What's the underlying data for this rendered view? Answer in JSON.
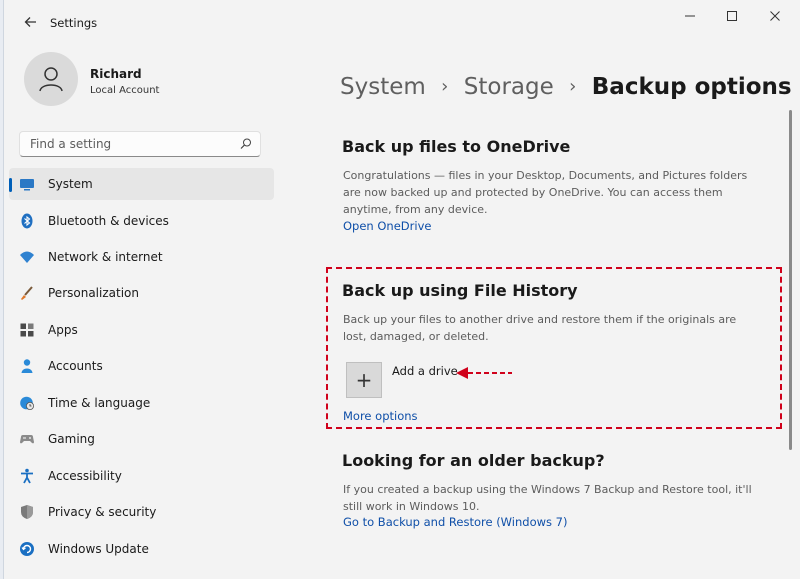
{
  "window": {
    "title": "Settings"
  },
  "user": {
    "name": "Richard",
    "account_type": "Local Account"
  },
  "search": {
    "placeholder": "Find a setting"
  },
  "nav": [
    {
      "label": "System",
      "icon": "monitor-icon",
      "active": true
    },
    {
      "label": "Bluetooth & devices",
      "icon": "bluetooth-icon"
    },
    {
      "label": "Network & internet",
      "icon": "wifi-icon"
    },
    {
      "label": "Personalization",
      "icon": "brush-icon"
    },
    {
      "label": "Apps",
      "icon": "apps-icon"
    },
    {
      "label": "Accounts",
      "icon": "person-icon"
    },
    {
      "label": "Time & language",
      "icon": "globe-clock-icon"
    },
    {
      "label": "Gaming",
      "icon": "gamepad-icon"
    },
    {
      "label": "Accessibility",
      "icon": "accessibility-icon"
    },
    {
      "label": "Privacy & security",
      "icon": "shield-icon"
    },
    {
      "label": "Windows Update",
      "icon": "update-icon"
    }
  ],
  "breadcrumb": {
    "part1": "System",
    "part2": "Storage",
    "current": "Backup options",
    "separator": "›"
  },
  "sections": {
    "onedrive": {
      "title": "Back up files to OneDrive",
      "description": "Congratulations — files in your Desktop, Documents, and Pictures folders are now backed up and protected by OneDrive. You can access them anytime, from any device.",
      "link": "Open OneDrive"
    },
    "file_history": {
      "title": "Back up using File History",
      "description": "Back up your files to another drive and restore them if the originals are lost, damaged, or deleted.",
      "add_drive_label": "Add a drive",
      "add_drive_icon": "+",
      "link": "More options"
    },
    "older_backup": {
      "title": "Looking for an older backup?",
      "description": "If you created a backup using the Windows 7 Backup and Restore tool, it'll still work in Windows 10.",
      "link": "Go to Backup and Restore (Windows 7)"
    }
  },
  "colors": {
    "accent": "#005fb8",
    "annotation": "#d0011b",
    "link": "#0f4fa8"
  }
}
